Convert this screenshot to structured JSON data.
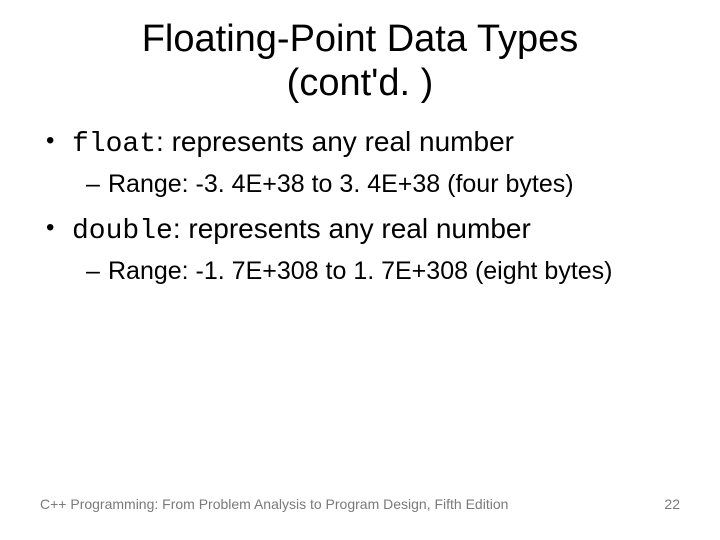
{
  "title_line1": "Floating-Point Data Types",
  "title_line2": "(cont'd. )",
  "items": [
    {
      "code": "float",
      "desc": ": represents any real number",
      "sub": "Range: -3. 4E+38 to 3. 4E+38 (four bytes)"
    },
    {
      "code": "double",
      "desc": ": represents any real number",
      "sub": "Range: -1. 7E+308 to 1. 7E+308 (eight bytes)"
    }
  ],
  "footer_text": "C++ Programming: From Problem Analysis to Program Design, Fifth Edition",
  "page_number": "22"
}
